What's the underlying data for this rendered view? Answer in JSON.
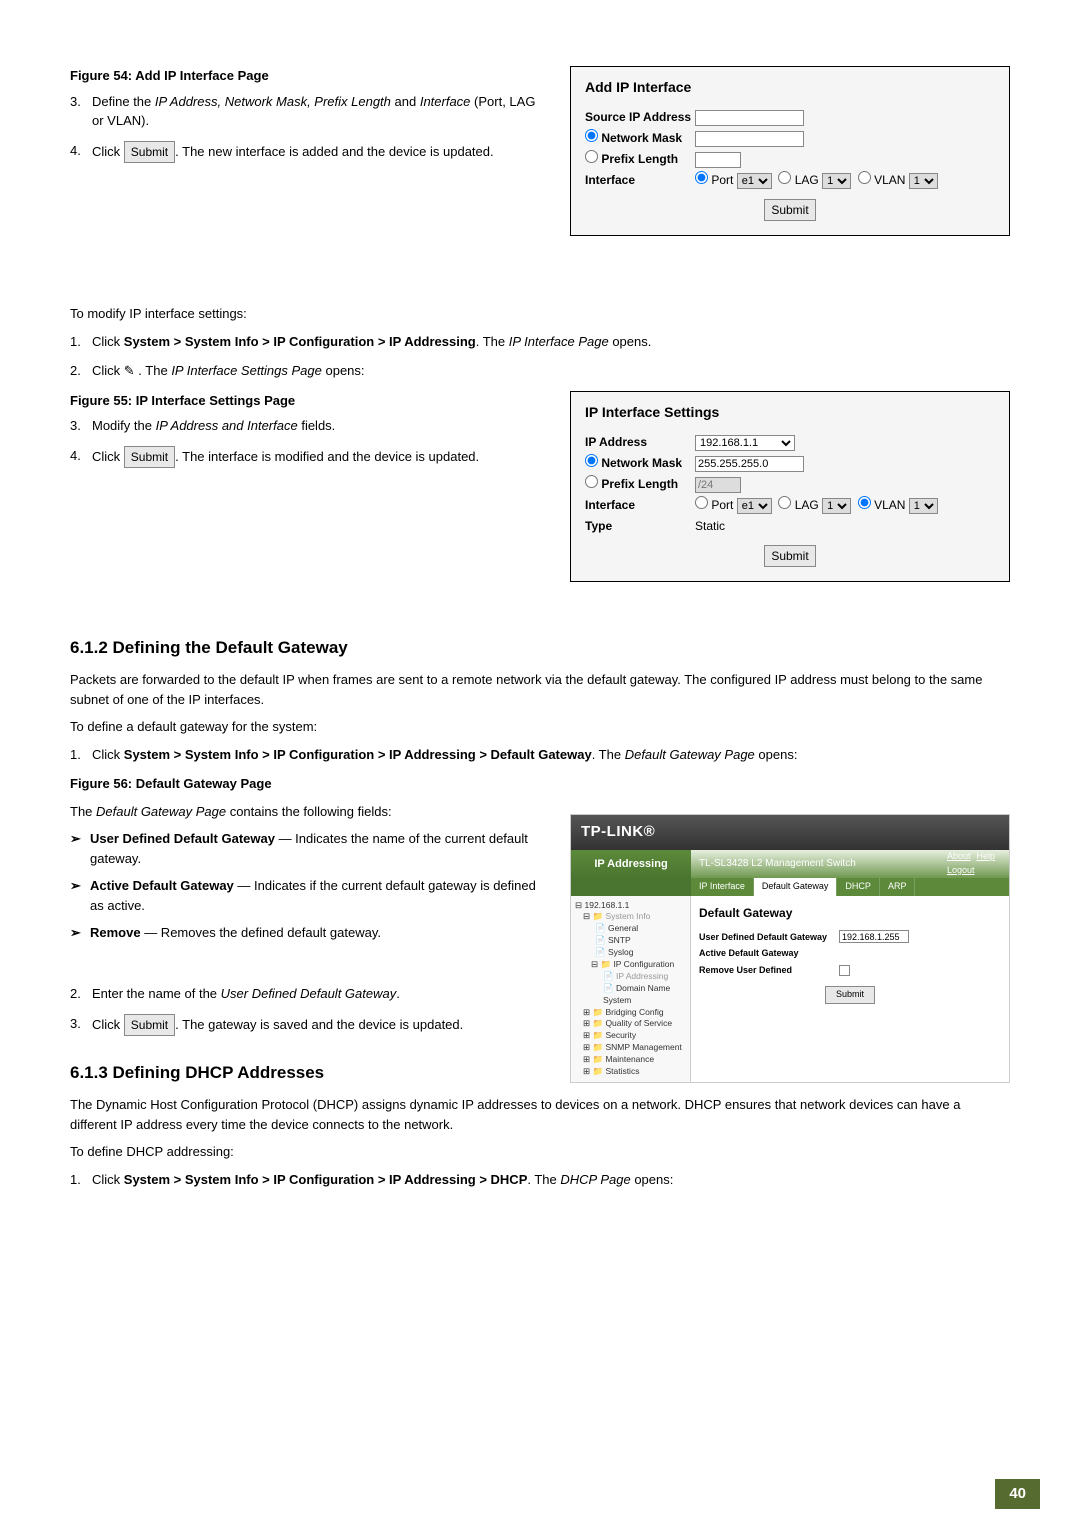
{
  "figure54": {
    "caption": "Figure 54: Add IP Interface Page"
  },
  "step54": {
    "item3_num": "3.",
    "item3_txt_a": "Define the ",
    "item3_txt_b": "IP Address, Network Mask, Prefix Length",
    "item3_txt_c": " and ",
    "item3_txt_d": "Interface",
    "item3_txt_e": " (Port, LAG or VLAN).",
    "item4_num": "4.",
    "item4_txt_a": "Click ",
    "item4_btn": "Submit",
    "item4_txt_b": ". The new interface is added and the device is updated."
  },
  "panelAdd": {
    "title": "Add IP Interface",
    "source_ip": "Source IP Address",
    "network_mask": "Network Mask",
    "prefix_length": "Prefix Length",
    "interface": "Interface",
    "port_val": "e1",
    "lag_val": "1",
    "vlan_val": "1",
    "port_lbl": "Port",
    "lag_lbl": "LAG",
    "vlan_lbl": "VLAN",
    "submit": "Submit"
  },
  "modify": {
    "intro": "To modify IP interface settings:",
    "item1_num": "1.",
    "item1_a": "Click ",
    "item1_b": "System > System Info > IP Configuration > IP Addressing",
    "item1_c": ". The ",
    "item1_d": "IP Interface Page",
    "item1_e": " opens.",
    "item2_num": "2.",
    "item2_a": "Click ",
    "item2_b": " . The ",
    "item2_c": "IP Interface Settings Page",
    "item2_d": " opens:"
  },
  "figure55": {
    "caption": "Figure 55: IP Interface Settings Page"
  },
  "step55": {
    "item3_num": "3.",
    "item3_a": "Modify the ",
    "item3_b": "IP Address and Interface",
    "item3_c": " fields.",
    "item4_num": "4.",
    "item4_a": "Click ",
    "item4_btn": "Submit",
    "item4_b": ". The interface is modified and the device is updated."
  },
  "panelSettings": {
    "title": "IP Interface Settings",
    "ip_address": "IP Address",
    "ip_val": "192.168.1.1",
    "network_mask": "Network Mask",
    "mask_val": "255.255.255.0",
    "prefix_length": "Prefix Length",
    "prefix_val": "/24",
    "interface": "Interface",
    "port_lbl": "Port",
    "port_val": "e1",
    "lag_lbl": "LAG",
    "lag_val": "1",
    "vlan_lbl": "VLAN",
    "vlan_val": "1",
    "type": "Type",
    "type_val": "Static",
    "submit": "Submit"
  },
  "h612": "6.1.2  Defining the Default Gateway",
  "gw_para": "Packets are forwarded to the default IP when frames are sent to a remote network via the default gateway. The configured IP address must belong to the same subnet of one of the IP interfaces.",
  "gw_define": "To define a default gateway for the system:",
  "gw_step1_num": "1.",
  "gw_step1_a": "Click ",
  "gw_step1_b": "System > System Info > IP Configuration > IP Addressing > Default Gateway",
  "gw_step1_c": ". The ",
  "gw_step1_d": "Default Gateway Page",
  "gw_step1_e": " opens:",
  "figure56": {
    "caption": "Figure 56: Default Gateway Page"
  },
  "gw_desc": {
    "intro_a": "The ",
    "intro_b": "Default Gateway Page",
    "intro_c": " contains the following fields:",
    "b1_lbl": "User Defined Default Gateway",
    "b1_txt": " — Indicates the name of the current default gateway.",
    "b2_lbl": "Active Default Gateway",
    "b2_txt": " — Indicates if the current default gateway is defined as active.",
    "b3_lbl": "Remove",
    "b3_txt": " — Removes the defined default gateway."
  },
  "gw_step2_num": "2.",
  "gw_step2_a": "Enter the name of the ",
  "gw_step2_b": "User Defined Default Gateway",
  "gw_step2_c": ".",
  "gw_step3_num": "3.",
  "gw_step3_a": "Click ",
  "gw_step3_btn": "Submit",
  "gw_step3_b": ". The gateway is saved and the device is updated.",
  "ss": {
    "brand": "TP-LINK®",
    "banner_left": "IP Addressing",
    "banner_mid": "TL-SL3428 L2 Management Switch",
    "about": "About",
    "help": "Help",
    "logout": "Logout",
    "tab1": "IP Interface",
    "tab2": "Default Gateway",
    "tab3": "DHCP",
    "tab4": "ARP",
    "tree_root": "192.168.1.1",
    "tree_sys": "System Info",
    "tree_gen": "General",
    "tree_sntp": "SNTP",
    "tree_syslog": "Syslog",
    "tree_ipconf": "IP Configuration",
    "tree_ipaddr": "IP Addressing",
    "tree_dns": "Domain Name System",
    "tree_bridging": "Bridging Config",
    "tree_qos": "Quality of Service",
    "tree_sec": "Security",
    "tree_snmp": "SNMP Management",
    "tree_maint": "Maintenance",
    "tree_stats": "Statistics",
    "main_title": "Default Gateway",
    "row1_lbl": "User Defined Default Gateway",
    "row1_val": "192.168.1.255",
    "row2_lbl": "Active Default Gateway",
    "row3_lbl": "Remove User Defined",
    "submit": "Submit"
  },
  "h613": "6.1.3  Defining DHCP Addresses",
  "dhcp_para": "The Dynamic Host Configuration Protocol (DHCP) assigns dynamic IP addresses to devices on a network. DHCP ensures that network devices can have a different IP address every time the device connects to the network.",
  "dhcp_define": "To define DHCP addressing:",
  "dhcp_step1_num": "1.",
  "dhcp_step1_a": "Click ",
  "dhcp_step1_b": "System > System Info > IP Configuration > IP Addressing > DHCP",
  "dhcp_step1_c": ". The ",
  "dhcp_step1_d": "DHCP Page",
  "dhcp_step1_e": " opens:",
  "page_number": "40"
}
